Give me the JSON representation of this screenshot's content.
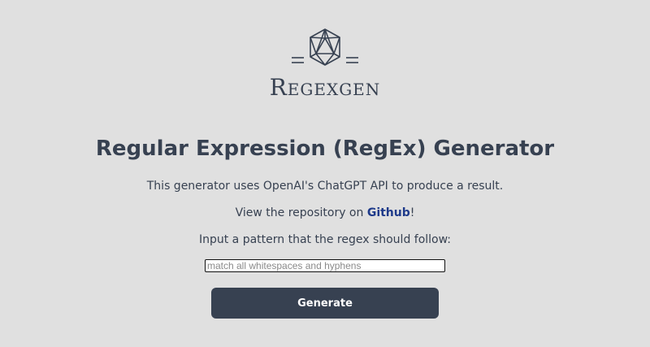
{
  "logo": {
    "text": "Regexgen",
    "icon": "icosahedron-with-equals-icon"
  },
  "title": "Regular Expression (RegEx) Generator",
  "description": "This generator uses OpenAI's ChatGPT API to produce a result.",
  "repo": {
    "prefix": "View the repository on ",
    "link_label": "Github",
    "suffix": "!"
  },
  "instruction": "Input a pattern that the regex should follow:",
  "pattern_input": {
    "placeholder": "match all whitespaces and hyphens",
    "value": ""
  },
  "generate_button": {
    "label": "Generate"
  },
  "colors": {
    "background": "#e0e0e0",
    "text": "#374151",
    "button": "#374151",
    "link": "#1e3a8a"
  }
}
